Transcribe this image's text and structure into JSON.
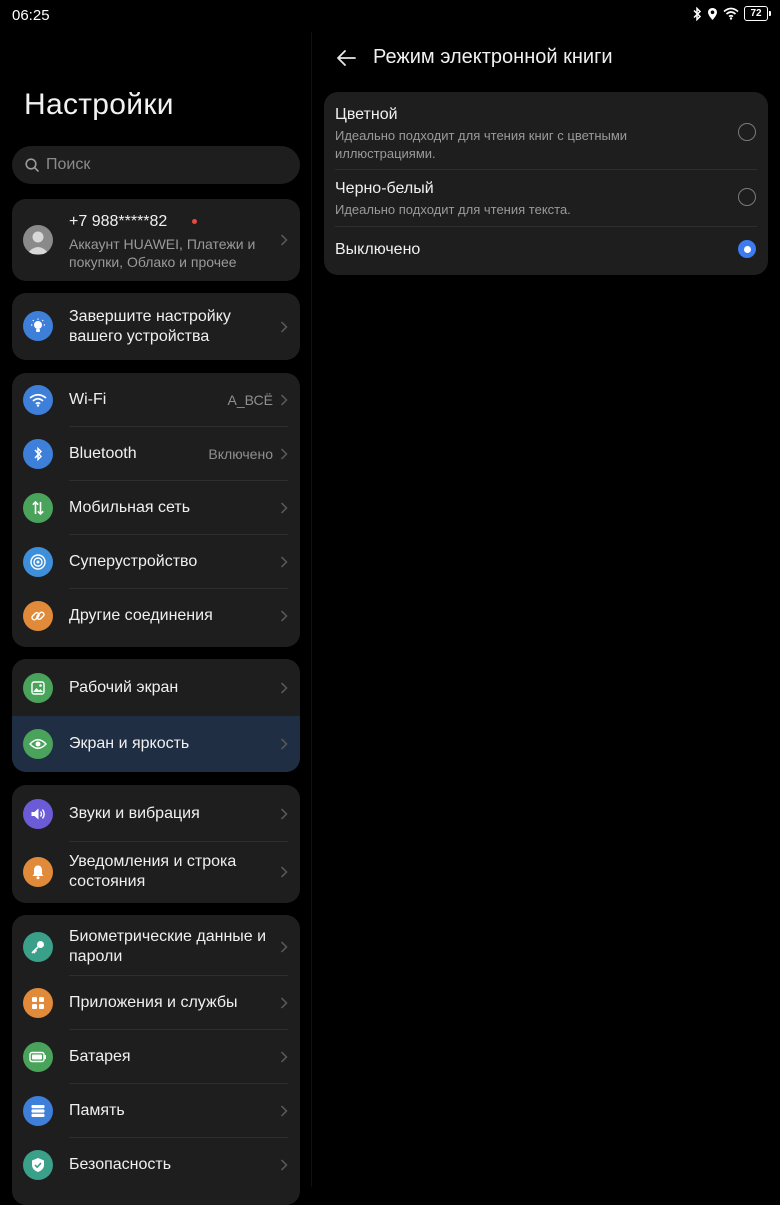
{
  "status": {
    "time": "06:25",
    "battery": "72"
  },
  "left": {
    "title": "Настройки",
    "search_placeholder": "Поиск",
    "account": {
      "phone": "+7 988*****82",
      "subtitle": "Аккаунт HUAWEI, Платежи и покупки, Облако и прочее"
    },
    "setup": {
      "label": "Завершите настройку вашего устройства"
    },
    "groups": [
      [
        {
          "label": "Wi-Fi",
          "value": "A_ВСЁ",
          "icon": "wifi-icon",
          "color": "#3d7fd9"
        },
        {
          "label": "Bluetooth",
          "value": "Включено",
          "icon": "bluetooth-icon",
          "color": "#3d7fd9"
        },
        {
          "label": "Мобильная сеть",
          "value": "",
          "icon": "mobile-network-icon",
          "color": "#4aa35a"
        },
        {
          "label": "Суперустройство",
          "value": "",
          "icon": "super-device-icon",
          "color": "#3d8fd9"
        },
        {
          "label": "Другие соединения",
          "value": "",
          "icon": "link-icon",
          "color": "#e08a3a"
        }
      ],
      [
        {
          "label": "Рабочий экран",
          "value": "",
          "icon": "home-screen-icon",
          "color": "#4aa35a"
        },
        {
          "label": "Экран и яркость",
          "value": "",
          "icon": "eye-icon",
          "color": "#4aa35a"
        }
      ],
      [
        {
          "label": "Звуки и вибрация",
          "value": "",
          "icon": "speaker-icon",
          "color": "#6b5bd6"
        },
        {
          "label": "Уведомления и строка состояния",
          "value": "",
          "icon": "bell-icon",
          "color": "#e08a3a"
        }
      ],
      [
        {
          "label": "Биометрические данные и пароли",
          "value": "",
          "icon": "key-icon",
          "color": "#3aa08a"
        },
        {
          "label": "Приложения и службы",
          "value": "",
          "icon": "apps-icon",
          "color": "#e08a3a"
        },
        {
          "label": "Батарея",
          "value": "",
          "icon": "battery-icon",
          "color": "#4aa35a"
        },
        {
          "label": "Память",
          "value": "",
          "icon": "storage-icon",
          "color": "#3d7fd9"
        },
        {
          "label": "Безопасность",
          "value": "",
          "icon": "shield-icon",
          "color": "#3aa08a"
        }
      ]
    ]
  },
  "right": {
    "title": "Режим электронной книги",
    "options": [
      {
        "title": "Цветной",
        "subtitle": "Идеально подходит для чтения книг с цветными иллюстрациями.",
        "selected": false
      },
      {
        "title": "Черно-белый",
        "subtitle": "Идеально подходит для чтения текста.",
        "selected": false
      },
      {
        "title": "Выключено",
        "subtitle": "",
        "selected": true
      }
    ]
  }
}
